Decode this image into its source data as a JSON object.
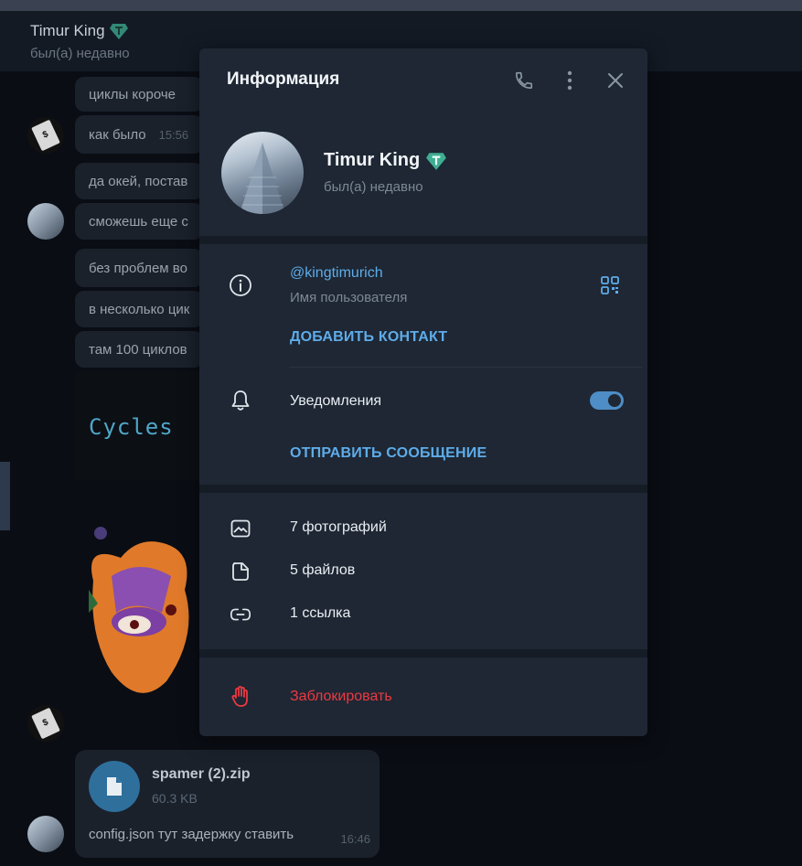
{
  "chat": {
    "name": "Timur King",
    "status": "был(а) недавно",
    "messages": [
      {
        "text": "циклы короче",
        "time": ""
      },
      {
        "text": "как было",
        "time": "15:56"
      },
      {
        "text": "да окей, постав",
        "time": ""
      },
      {
        "text": "сможешь еще с",
        "time": ""
      },
      {
        "text": "без проблем во",
        "time": ""
      },
      {
        "text": "в несколько цик",
        "time": ""
      },
      {
        "text": "там 100 циклов",
        "time": ""
      }
    ],
    "code_image_text": "Cycles",
    "file": {
      "name": "spamer (2).zip",
      "size": "60.3 KB",
      "caption": "config.json тут задержку ставить",
      "time": "16:46"
    }
  },
  "dialog": {
    "title": "Информация",
    "profile": {
      "name": "Timur King",
      "status": "был(а) недавно"
    },
    "username": {
      "value": "@kingtimurich",
      "label": "Имя пользователя"
    },
    "add_contact_label": "ДОБАВИТЬ КОНТАКТ",
    "notifications": {
      "label": "Уведомления",
      "enabled": true
    },
    "send_message_label": "ОТПРАВИТЬ СООБЩЕНИЕ",
    "media": {
      "photos": "7 фотографий",
      "files": "5 файлов",
      "links": "1 ссылка"
    },
    "block_label": "Заблокировать"
  },
  "icons": [
    "phone-icon",
    "more-vertical-icon",
    "close-icon",
    "info-icon",
    "qr-code-icon",
    "bell-icon",
    "photo-icon",
    "file-icon",
    "link-icon",
    "hand-stop-icon",
    "verified-badge-icon"
  ],
  "colors": {
    "accent": "#5eacea",
    "danger": "#ec3942",
    "dialog_bg": "#1e2733",
    "badge": "#3fae93"
  }
}
